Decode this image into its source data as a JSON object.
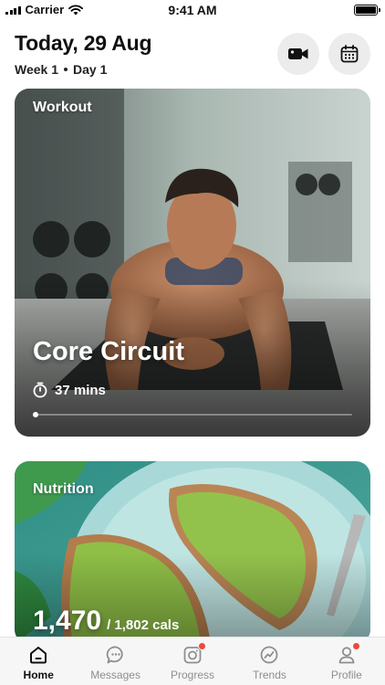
{
  "status_bar": {
    "carrier": "Carrier",
    "time": "9:41 AM"
  },
  "header": {
    "date": "Today, 29 Aug",
    "week": "Week 1",
    "day": "Day 1",
    "video_icon": "video-camera-icon",
    "calendar_icon": "calendar-icon"
  },
  "workout_card": {
    "label": "Workout",
    "title": "Core Circuit",
    "duration": "37 mins",
    "progress": 0.0
  },
  "nutrition_card": {
    "label": "Nutrition",
    "calories": "1,470",
    "calories_goal": "/ 1,802 cals"
  },
  "tabs": [
    {
      "label": "Home",
      "icon": "home-icon",
      "active": true,
      "badge": false
    },
    {
      "label": "Messages",
      "icon": "messages-icon",
      "active": false,
      "badge": false
    },
    {
      "label": "Progress",
      "icon": "progress-camera-icon",
      "active": false,
      "badge": true
    },
    {
      "label": "Trends",
      "icon": "trends-icon",
      "active": false,
      "badge": false
    },
    {
      "label": "Profile",
      "icon": "profile-icon",
      "active": false,
      "badge": true
    }
  ],
  "colors": {
    "badge": "#f0473c",
    "active_tab": "#111111",
    "inactive_tab": "#8e8e93"
  }
}
